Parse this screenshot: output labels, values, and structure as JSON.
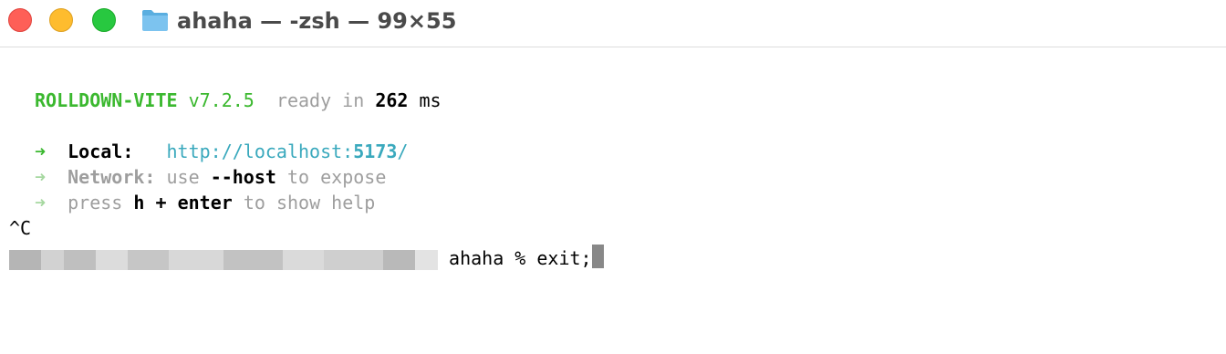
{
  "window": {
    "title": "ahaha — -zsh — 99×55",
    "folder_icon": "folder-icon"
  },
  "terminal": {
    "banner": {
      "name": "ROLLDOWN-VITE",
      "version": "v7.2.5",
      "ready_prefix": "ready in",
      "ready_value": "262",
      "ready_unit": "ms"
    },
    "local": {
      "arrow": "➜",
      "label": "Local:",
      "url_prefix": "http://localhost:",
      "url_port": "5173",
      "url_suffix": "/"
    },
    "network": {
      "arrow": "➜",
      "label": "Network:",
      "use": "use",
      "flag": "--host",
      "rest": "to expose"
    },
    "help": {
      "arrow": "➜",
      "press": "press",
      "keys": "h + enter",
      "rest": "to show help"
    },
    "interrupt": "^C",
    "prompt": {
      "text": "ahaha % exit;"
    }
  },
  "colors": {
    "close": "#fe5f57",
    "minimize": "#febc2e",
    "zoom": "#28c840",
    "vite_green": "#3bb82f",
    "link_cyan": "#3aa9bd",
    "dim_gray": "#9e9e9e"
  }
}
